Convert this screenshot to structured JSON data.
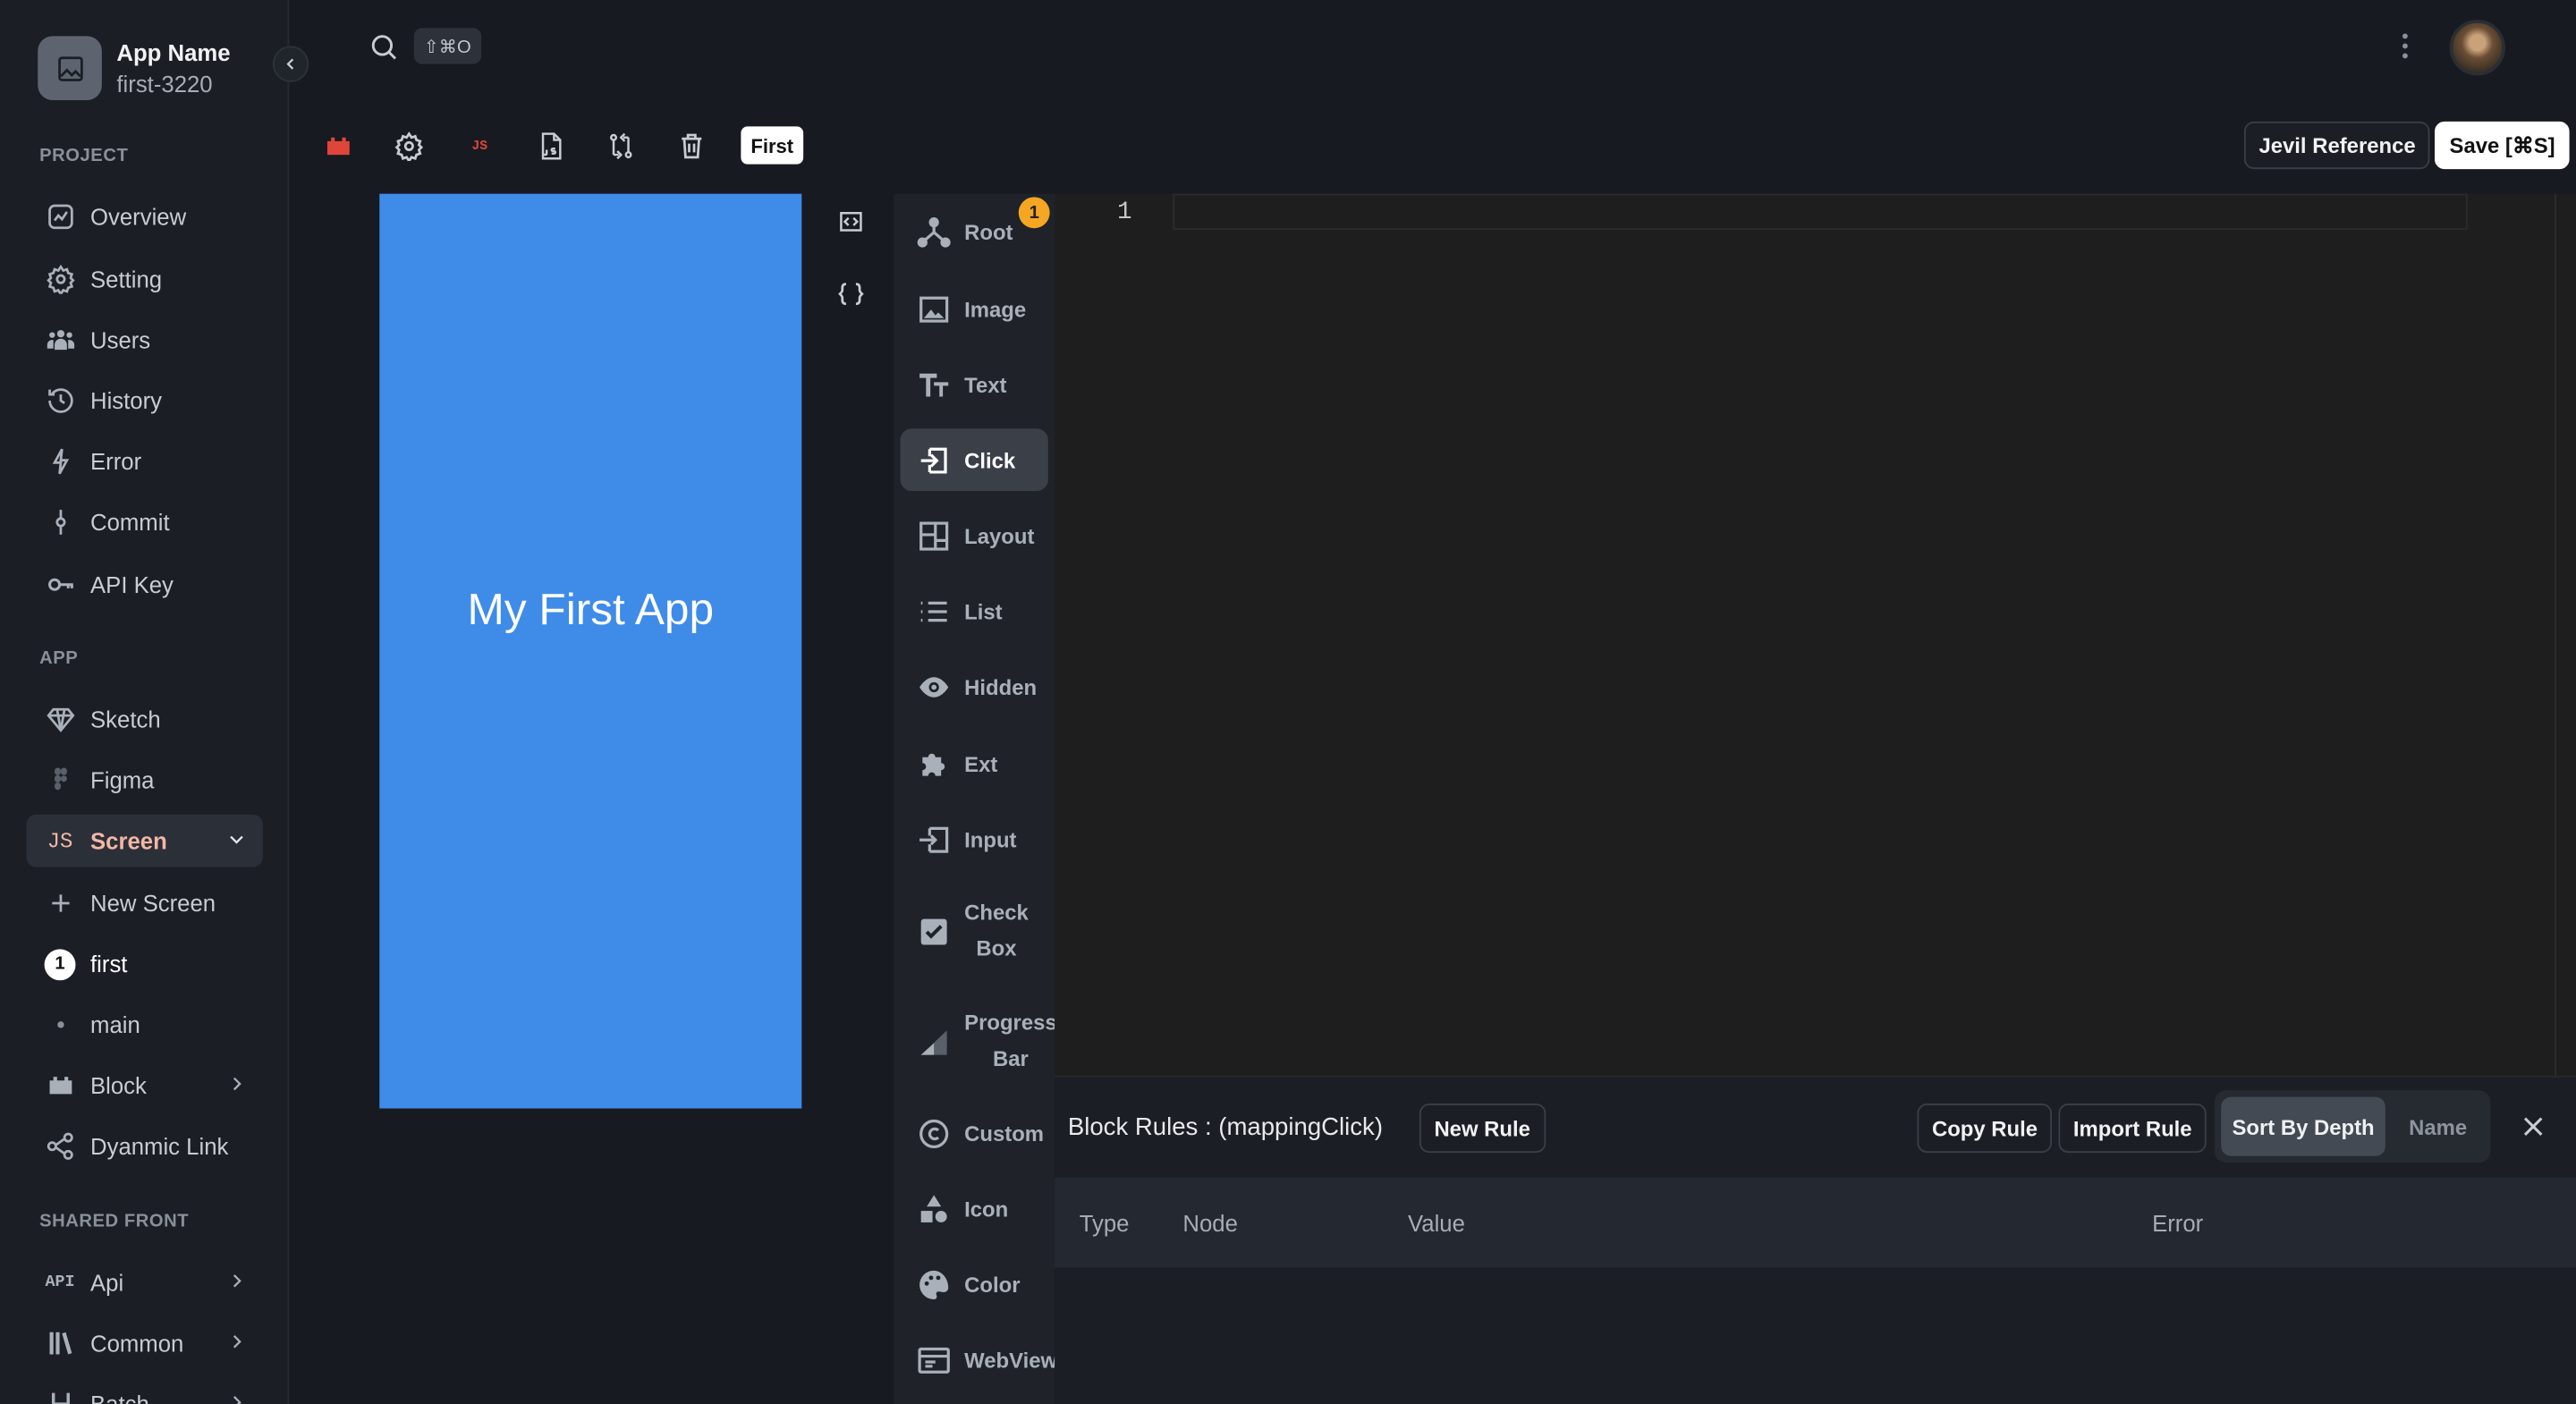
{
  "app": {
    "name": "App Name",
    "id": "first-3220"
  },
  "sidebar": {
    "project_label": "PROJECT",
    "project_items": [
      {
        "label": "Overview",
        "icon": "chart-line-icon"
      },
      {
        "label": "Setting",
        "icon": "gear-icon"
      },
      {
        "label": "Users",
        "icon": "users-icon"
      },
      {
        "label": "History",
        "icon": "history-icon"
      },
      {
        "label": "Error",
        "icon": "bolt-icon"
      },
      {
        "label": "Commit",
        "icon": "commit-icon"
      },
      {
        "label": "API Key",
        "icon": "key-icon"
      }
    ],
    "app_label": "APP",
    "app_items": [
      {
        "label": "Sketch",
        "icon": "diamond-icon"
      },
      {
        "label": "Figma",
        "icon": "figma-icon"
      },
      {
        "label": "Screen",
        "icon": "js-icon",
        "badge": "JS"
      },
      {
        "label": "New Screen",
        "icon": "plus-icon"
      },
      {
        "label": "first",
        "badge": "1"
      },
      {
        "label": "main"
      },
      {
        "label": "Block",
        "icon": "block-icon"
      },
      {
        "label": "Dyanmic Link",
        "icon": "link-icon"
      }
    ],
    "shared_label": "SHARED FRONT",
    "shared_items": [
      {
        "label": "Api",
        "badge": "API"
      },
      {
        "label": "Common",
        "icon": "books-icon"
      },
      {
        "label": "Batch",
        "icon": "batch-icon"
      }
    ]
  },
  "topbar": {
    "shortcut": "⇧⌘O"
  },
  "toolbar": {
    "screen_chip": "First",
    "reference_label": "Jevil Reference",
    "save_label": "Save [⌘S]",
    "js_label": "JS"
  },
  "preview": {
    "title": "My First App",
    "background": "#3f8be8"
  },
  "palette": {
    "badge": "1",
    "items": [
      {
        "label": "Root",
        "icon": "root-icon"
      },
      {
        "label": "Image",
        "icon": "image-icon"
      },
      {
        "label": "Text",
        "icon": "text-icon"
      },
      {
        "label": "Click",
        "icon": "click-icon",
        "active": true
      },
      {
        "label": "Layout",
        "icon": "layout-icon"
      },
      {
        "label": "List",
        "icon": "list-icon"
      },
      {
        "label": "Hidden",
        "icon": "eye-icon"
      },
      {
        "label": "Ext",
        "icon": "puzzle-icon"
      },
      {
        "label": "Input",
        "icon": "input-icon"
      },
      {
        "label": "Check Box",
        "line1": "Check",
        "line2": "Box",
        "icon": "checkbox-icon"
      },
      {
        "label": "Progress Bar",
        "line1": "Progress",
        "line2": "Bar",
        "icon": "progress-icon"
      },
      {
        "label": "Custom",
        "icon": "copyright-icon"
      },
      {
        "label": "Icon",
        "icon": "shapes-icon"
      },
      {
        "label": "Color",
        "icon": "palette-icon"
      },
      {
        "label": "WebView",
        "icon": "webview-icon"
      }
    ]
  },
  "editor": {
    "line_number": "1"
  },
  "rules": {
    "title": "Block Rules : (mappingClick)",
    "new_rule": "New Rule",
    "copy_rule": "Copy Rule",
    "import_rule": "Import Rule",
    "sort_depth": "Sort By Depth",
    "sort_name": "Name",
    "columns": [
      "Type",
      "Node",
      "Value",
      "Error"
    ]
  }
}
